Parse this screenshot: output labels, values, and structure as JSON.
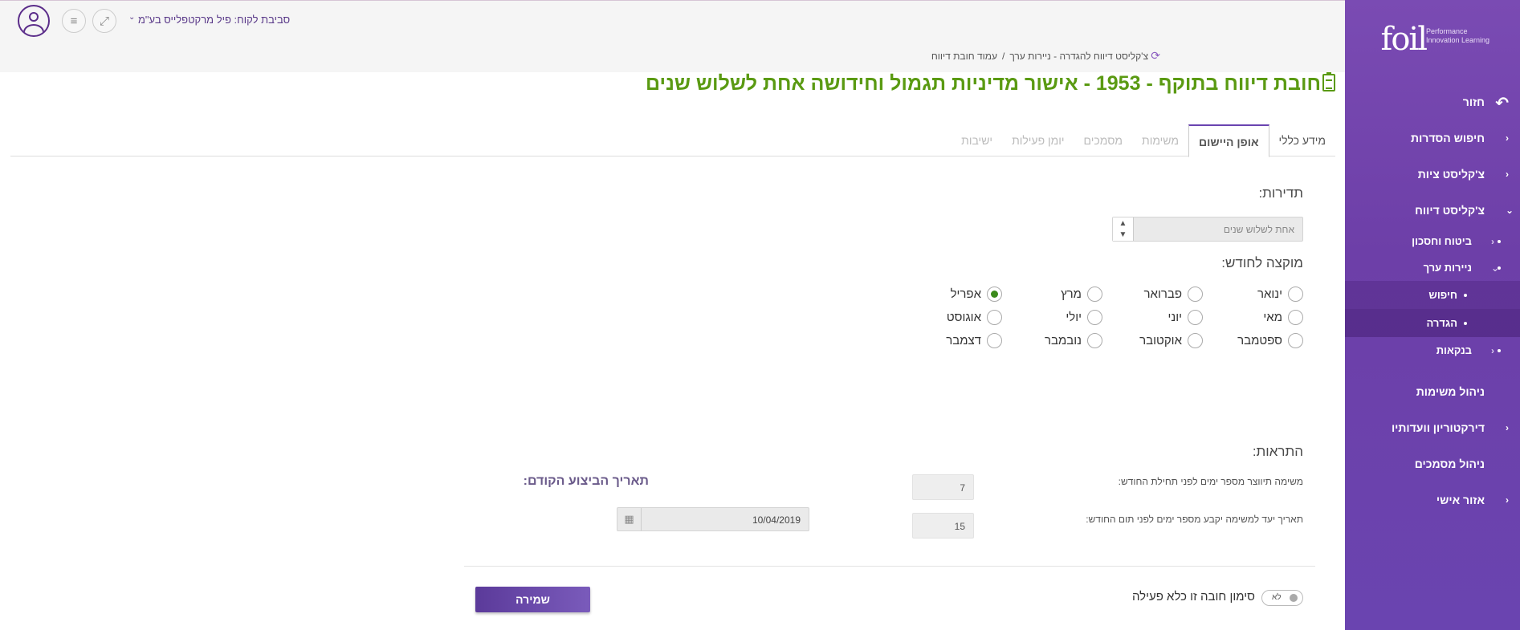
{
  "sidebar": {
    "logo_mark": "foil",
    "logo_text": "Performance Innovation Learning",
    "back_label": "חזור",
    "items": [
      {
        "label": "חיפוש הסדרות"
      },
      {
        "label": "צ'קליסט ציות"
      },
      {
        "label": "צ'קליסט דיווח"
      }
    ],
    "sub_items": [
      {
        "label": "ביטוח וחסכון"
      },
      {
        "label": "ניירות ערך"
      }
    ],
    "sub_sub_items": [
      {
        "label": "חיפוש"
      },
      {
        "label": "הגדרה"
      }
    ],
    "banks_label": "בנקאות",
    "lower_items": [
      {
        "label": "ניהול משימות"
      },
      {
        "label": "דירקטוריון וועדותיו"
      },
      {
        "label": "ניהול מסמכים"
      },
      {
        "label": "אזור אישי"
      }
    ]
  },
  "header": {
    "client": "סביבת לקוח: פיל מרקטפלייס בע\"מ",
    "breadcrumb": [
      "צ'קליסט דיווח להגדרה - ניירות ערך",
      "עמוד חובת דיווח"
    ]
  },
  "title": "חובת דיווח בתוקף - 1953 - אישור מדיניות תגמול וחידושה אחת לשלוש שנים",
  "tabs": [
    "מידע כללי",
    "אופן היישום",
    "משימות",
    "מסמכים",
    "יומן פעילות",
    "ישיבות"
  ],
  "form": {
    "frequency_label": "תדירות:",
    "frequency_value": "אחת לשלוש שנים",
    "month_label": "מוקצה לחודש:",
    "months": [
      "ינואר",
      "פברואר",
      "מרץ",
      "אפריל",
      "מאי",
      "יוני",
      "יולי",
      "אוגוסט",
      "ספטמבר",
      "אוקטובר",
      "נובמבר",
      "דצמבר"
    ],
    "selected_month": "אפריל",
    "alerts_label": "התראות:",
    "task_days_label": "משימה תיווצר מספר ימים לפני תחילת החודש:",
    "task_days_value": "7",
    "due_days_label": "תאריך יעד למשימה יקבע מספר ימים לפני תום החודש:",
    "due_days_value": "15",
    "prev_date_label": "תאריך הביצוע הקודם:",
    "prev_date_value": "10/04/2019",
    "inactive_label": "סימון חובה זו כלא פעילה",
    "inactive_toggle": "לא",
    "save_label": "שמירה"
  },
  "colors": {
    "sidebar": "#6d3fa8",
    "title": "#5a9a12",
    "save": "#5b3a9a"
  }
}
